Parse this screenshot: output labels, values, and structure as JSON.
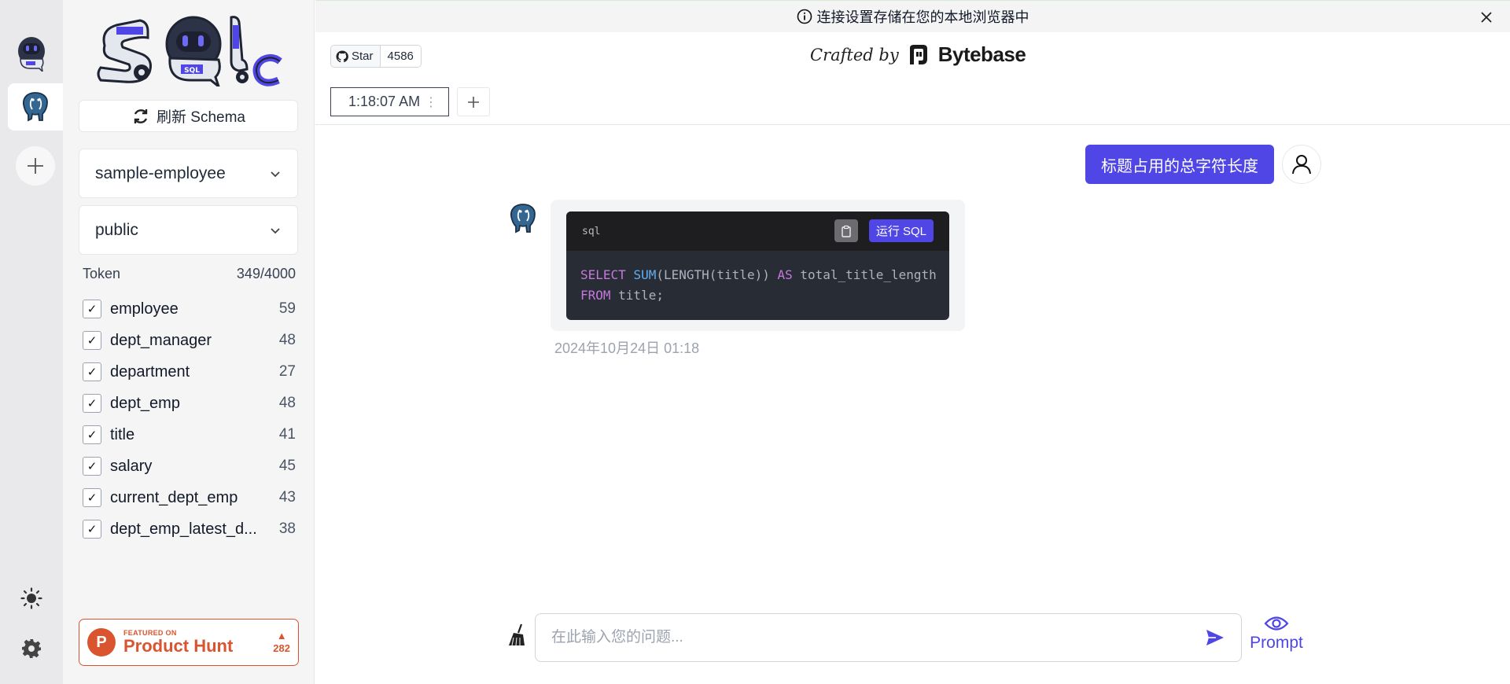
{
  "rail": {
    "items": [
      {
        "name": "sqlchat-bot-icon"
      },
      {
        "name": "postgres-elephant-icon"
      },
      {
        "name": "add-connection-icon"
      }
    ],
    "bottom": [
      "theme-sun-icon",
      "settings-gear-icon"
    ]
  },
  "sidebar": {
    "refresh_label": "刷新 Schema",
    "database": "sample-employee",
    "schema": "public",
    "token_label": "Token",
    "token_value": "349/4000",
    "tables": [
      {
        "name": "employee",
        "count": "59",
        "checked": true
      },
      {
        "name": "dept_manager",
        "count": "48",
        "checked": true
      },
      {
        "name": "department",
        "count": "27",
        "checked": true
      },
      {
        "name": "dept_emp",
        "count": "48",
        "checked": true
      },
      {
        "name": "title",
        "count": "41",
        "checked": true
      },
      {
        "name": "salary",
        "count": "45",
        "checked": true
      },
      {
        "name": "current_dept_emp",
        "count": "43",
        "checked": true
      },
      {
        "name": "dept_emp_latest_d...",
        "count": "38",
        "checked": true
      }
    ],
    "product_hunt": {
      "featured": "FEATURED ON",
      "name": "Product Hunt",
      "votes": "282"
    }
  },
  "banner": {
    "text": "连接设置存储在您的本地浏览器中"
  },
  "header": {
    "star_label": "Star",
    "star_count": "4586",
    "crafted_by": "Crafted by",
    "brand": "Bytebase"
  },
  "tabs": [
    {
      "label": "1:18:07 AM"
    }
  ],
  "chat": {
    "user_message": "标题占用的总字符长度",
    "code_lang": "sql",
    "run_label": "运行 SQL",
    "timestamp": "2024年10月24日 01:18"
  },
  "input": {
    "placeholder": "在此输入您的问题...",
    "value": ""
  },
  "prompt_label": "Prompt",
  "colors": {
    "accent": "#4f46e5",
    "product_hunt": "#da552f",
    "code_bg": "#282c34"
  }
}
